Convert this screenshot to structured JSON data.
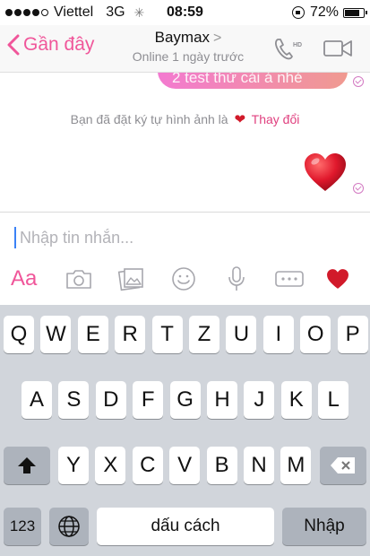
{
  "status_bar": {
    "carrier": "Viettel",
    "network": "3G",
    "time": "08:59",
    "battery": "72%",
    "signal_bars_filled": 4,
    "signal_bars_total": 5
  },
  "nav": {
    "back_label": "Gần đây",
    "contact_name": "Baymax",
    "status": "Online 1 ngày trước",
    "call_badge": "HD"
  },
  "chat": {
    "partial_message": "2 test thử cái á nhé",
    "notice_prefix": "Bạn đã đặt ký tự hình ảnh là",
    "notice_link": "Thay đổi",
    "heart_message": "heart-emoji"
  },
  "compose": {
    "placeholder": "Nhập tin nhắn...",
    "value": "",
    "aa_label": "Aa",
    "toolbar_icons": [
      "text-format-icon",
      "camera-icon",
      "gallery-icon",
      "emoji-icon",
      "microphone-icon",
      "more-icon",
      "heart-icon"
    ]
  },
  "keyboard": {
    "row1": [
      "Q",
      "W",
      "E",
      "R",
      "T",
      "Z",
      "U",
      "I",
      "O",
      "P"
    ],
    "row2": [
      "A",
      "S",
      "D",
      "F",
      "G",
      "H",
      "J",
      "K",
      "L"
    ],
    "row3": [
      "Y",
      "X",
      "C",
      "V",
      "B",
      "N",
      "M"
    ],
    "numbers_label": "123",
    "space_label": "dấu cách",
    "return_label": "Nhập"
  },
  "colors": {
    "accent": "#f0569a",
    "bubble_gradient_start": "#f37ad0",
    "bubble_gradient_end": "#f09a90",
    "heart": "#d11a2a",
    "keyboard_bg": "#d1d5db"
  }
}
